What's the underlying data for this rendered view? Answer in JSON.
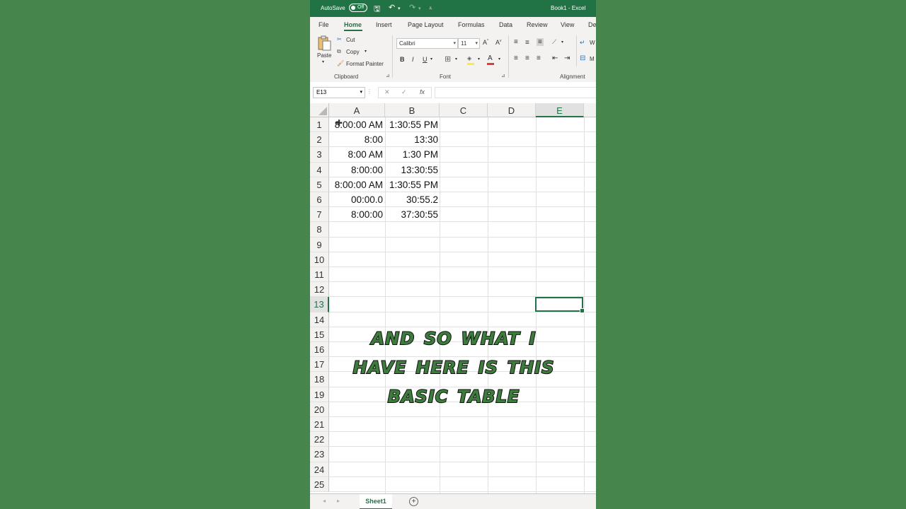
{
  "titlebar": {
    "autosave_label": "AutoSave",
    "autosave_state": "Off",
    "title": "Book1  -  Excel"
  },
  "ribbon_tabs": [
    "File",
    "Home",
    "Insert",
    "Page Layout",
    "Formulas",
    "Data",
    "Review",
    "View",
    "De"
  ],
  "clipboard": {
    "paste": "Paste",
    "cut": "Cut",
    "copy": "Copy",
    "format_painter": "Format Painter",
    "label": "Clipboard"
  },
  "font_group": {
    "font_name": "Calibri",
    "font_size": "11",
    "bold": "B",
    "italic": "I",
    "underline": "U",
    "label": "Font"
  },
  "alignment": {
    "wrap": "W",
    "merge": "M",
    "label": "Alignment"
  },
  "formula_bar": {
    "name_box": "E13",
    "cancel": "✕",
    "enter": "✓",
    "fx": "fx",
    "formula": ""
  },
  "columns": [
    "A",
    "B",
    "C",
    "D",
    "E"
  ],
  "selected_column": "E",
  "rows": [
    "1",
    "2",
    "3",
    "4",
    "5",
    "6",
    "7",
    "8",
    "9",
    "10",
    "11",
    "12",
    "13",
    "14",
    "15",
    "16",
    "17",
    "18",
    "19",
    "20",
    "21",
    "22",
    "23",
    "24",
    "25"
  ],
  "selected_row": "13",
  "cells": [
    {
      "a": "8:00:00 AM",
      "b": "1:30:55 PM"
    },
    {
      "a": "8:00",
      "b": "13:30"
    },
    {
      "a": "8:00 AM",
      "b": "1:30 PM"
    },
    {
      "a": "8:00:00",
      "b": "13:30:55"
    },
    {
      "a": "8:00:00 AM",
      "b": "1:30:55 PM"
    },
    {
      "a": "00:00.0",
      "b": "30:55.2"
    },
    {
      "a": "8:00:00",
      "b": "37:30:55"
    }
  ],
  "sheet": {
    "tab": "Sheet1",
    "add": "+"
  },
  "caption": {
    "line1": "And so what I",
    "line2": "have here is this",
    "line3": "basic table"
  }
}
